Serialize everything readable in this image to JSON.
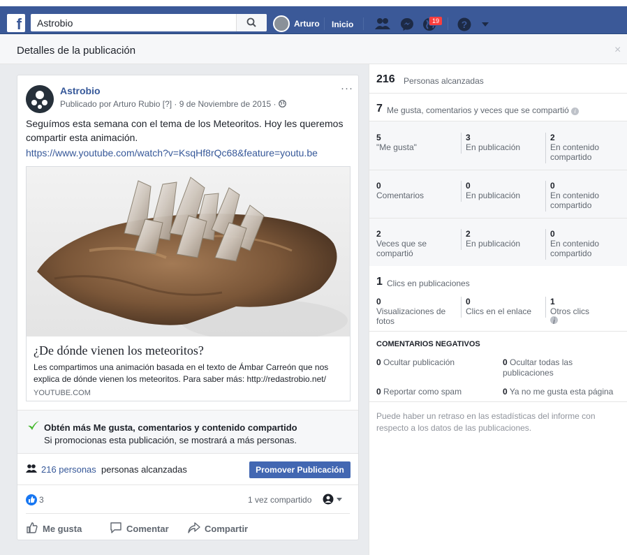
{
  "topbar": {
    "logo": "f",
    "search_value": "Astrobio",
    "user_name": "Arturo",
    "home_label": "Inicio",
    "notif_count": "19",
    "icons": [
      "friends-icon",
      "messenger-icon",
      "globe-icon",
      "help-icon",
      "caret-down-icon"
    ]
  },
  "subheader": {
    "title": "Detalles de la publicación",
    "close": "×"
  },
  "post": {
    "page_name": "Astrobio",
    "meta": "Publicado por Arturo Rubio [?] · 9 de Noviembre de 2015 ·",
    "more": "···",
    "text": "Seguímos esta semana con el tema de los Meteoritos. Hoy les queremos compartir esta animación.",
    "link": "https://www.youtube.com/watch?v=KsqHf8rQc68&feature=youtu.be",
    "link_card": {
      "title": "¿De dónde vienen los meteoritos?",
      "description": "Les compartimos una animación basada en el texto de Ámbar Carreón que nos explica de dónde vienen los meteoritos. Para saber más: http://redastrobio.net/",
      "domain": "YOUTUBE.COM"
    },
    "promo_title": "Obtén más Me gusta, comentarios y contenido compartido",
    "promo_sub": "Si promocionas esta publicación, se mostrará a más personas.",
    "reach_link": "216 personas",
    "reach_text": "personas alcanzadas",
    "promote_button": "Promover Publicación",
    "likes": "3",
    "shared": "1 vez compartido",
    "actions": {
      "like": "Me gusta",
      "comment": "Comentar",
      "share": "Compartir"
    }
  },
  "stats": {
    "reach_num": "216",
    "reach_label": "Personas alcanzadas",
    "engage_num": "7",
    "engage_label": "Me gusta, comentarios y veces que se compartió",
    "likes": {
      "total": "5",
      "total_label": "\"Me gusta\"",
      "post": "3",
      "post_label": "En publicación",
      "shared": "2",
      "shared_label": "En contenido compartido"
    },
    "comments": {
      "total": "0",
      "total_label": "Comentarios",
      "post": "0",
      "post_label": "En publicación",
      "shared": "0",
      "shared_label": "En contenido compartido"
    },
    "shares": {
      "total": "2",
      "total_label": "Veces que se compartió",
      "post": "2",
      "post_label": "En publicación",
      "shared": "0",
      "shared_label": "En contenido compartido"
    },
    "clicks_num": "1",
    "clicks_label": "Clics en publicaciones",
    "clicks": {
      "photo": "0",
      "photo_label": "Visualizaciones de fotos",
      "link": "0",
      "link_label": "Clics en el enlace",
      "other": "1",
      "other_label": "Otros clics"
    },
    "negative_title": "COMENTARIOS NEGATIVOS",
    "negative": {
      "hide_post_num": "0",
      "hide_post": "Ocultar publicación",
      "hide_all_num": "0",
      "hide_all": "Ocultar todas las publicaciones",
      "spam_num": "0",
      "spam": "Reportar como spam",
      "unlike_num": "0",
      "unlike": "Ya no me gusta esta página"
    },
    "note": "Puede haber un retraso en las estadísticas del informe con respecto a los datos de las publicaciones."
  },
  "colors": {
    "brand": "#3b5998",
    "link": "#365899",
    "button": "#4267b2",
    "badge": "#fa3e3e"
  }
}
